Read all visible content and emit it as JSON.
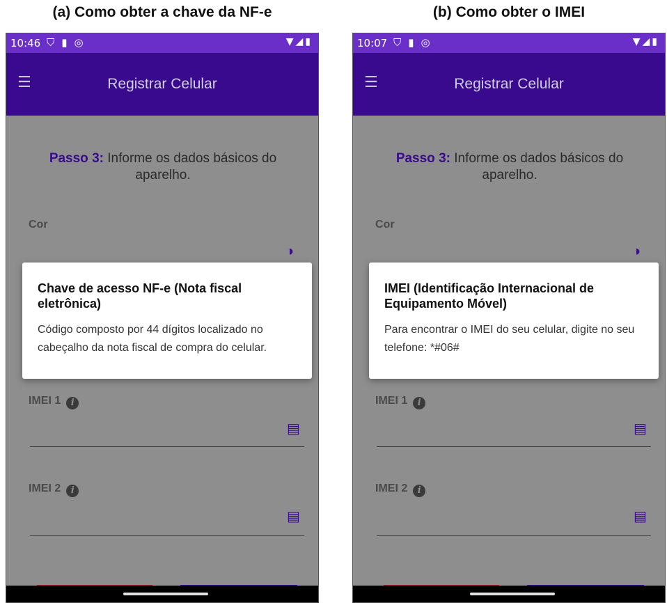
{
  "panels": [
    {
      "caption": "(a) Como obter a chave da NF-e",
      "status_time": "10:46",
      "app_title": "Registrar Celular",
      "step_label": "Passo 3:",
      "step_text": "Informe os dados básicos do aparelho.",
      "field_cor": "Cor",
      "field_imei1": "IMEI 1",
      "field_imei2": "IMEI 2",
      "dialog_title": "Chave de acesso NF-e (Nota fiscal eletrônica)",
      "dialog_text": "Código composto por 44 dígitos localizado no cabeçalho da nota fiscal de compra do celular."
    },
    {
      "caption": "(b) Como obter o IMEI",
      "status_time": "10:07",
      "app_title": "Registrar Celular",
      "step_label": "Passo 3:",
      "step_text": "Informe os dados básicos do aparelho.",
      "field_cor": "Cor",
      "field_imei1": "IMEI 1",
      "field_imei2": "IMEI 2",
      "dialog_title": "IMEI (Identificação Internacional de Equipamento Móvel)",
      "dialog_text": "Para encontrar o IMEI do seu celular, digite no seu telefone: *#06#"
    }
  ],
  "icons": {
    "status_left": "shield-icon sd-card-icon circle-icon",
    "status_right": "wifi-icon signal-icon battery-icon",
    "menu": "hamburger-menu-icon",
    "color": "contrast-icon",
    "imei": "phone-device-icon",
    "info": "info-icon"
  },
  "colors": {
    "status_bar": "#6a2ec9",
    "app_bar": "#3a0a8e",
    "accent": "#3a0a8e",
    "button_red": "#a0202a",
    "overlay_bg": "#8e8e8e"
  }
}
